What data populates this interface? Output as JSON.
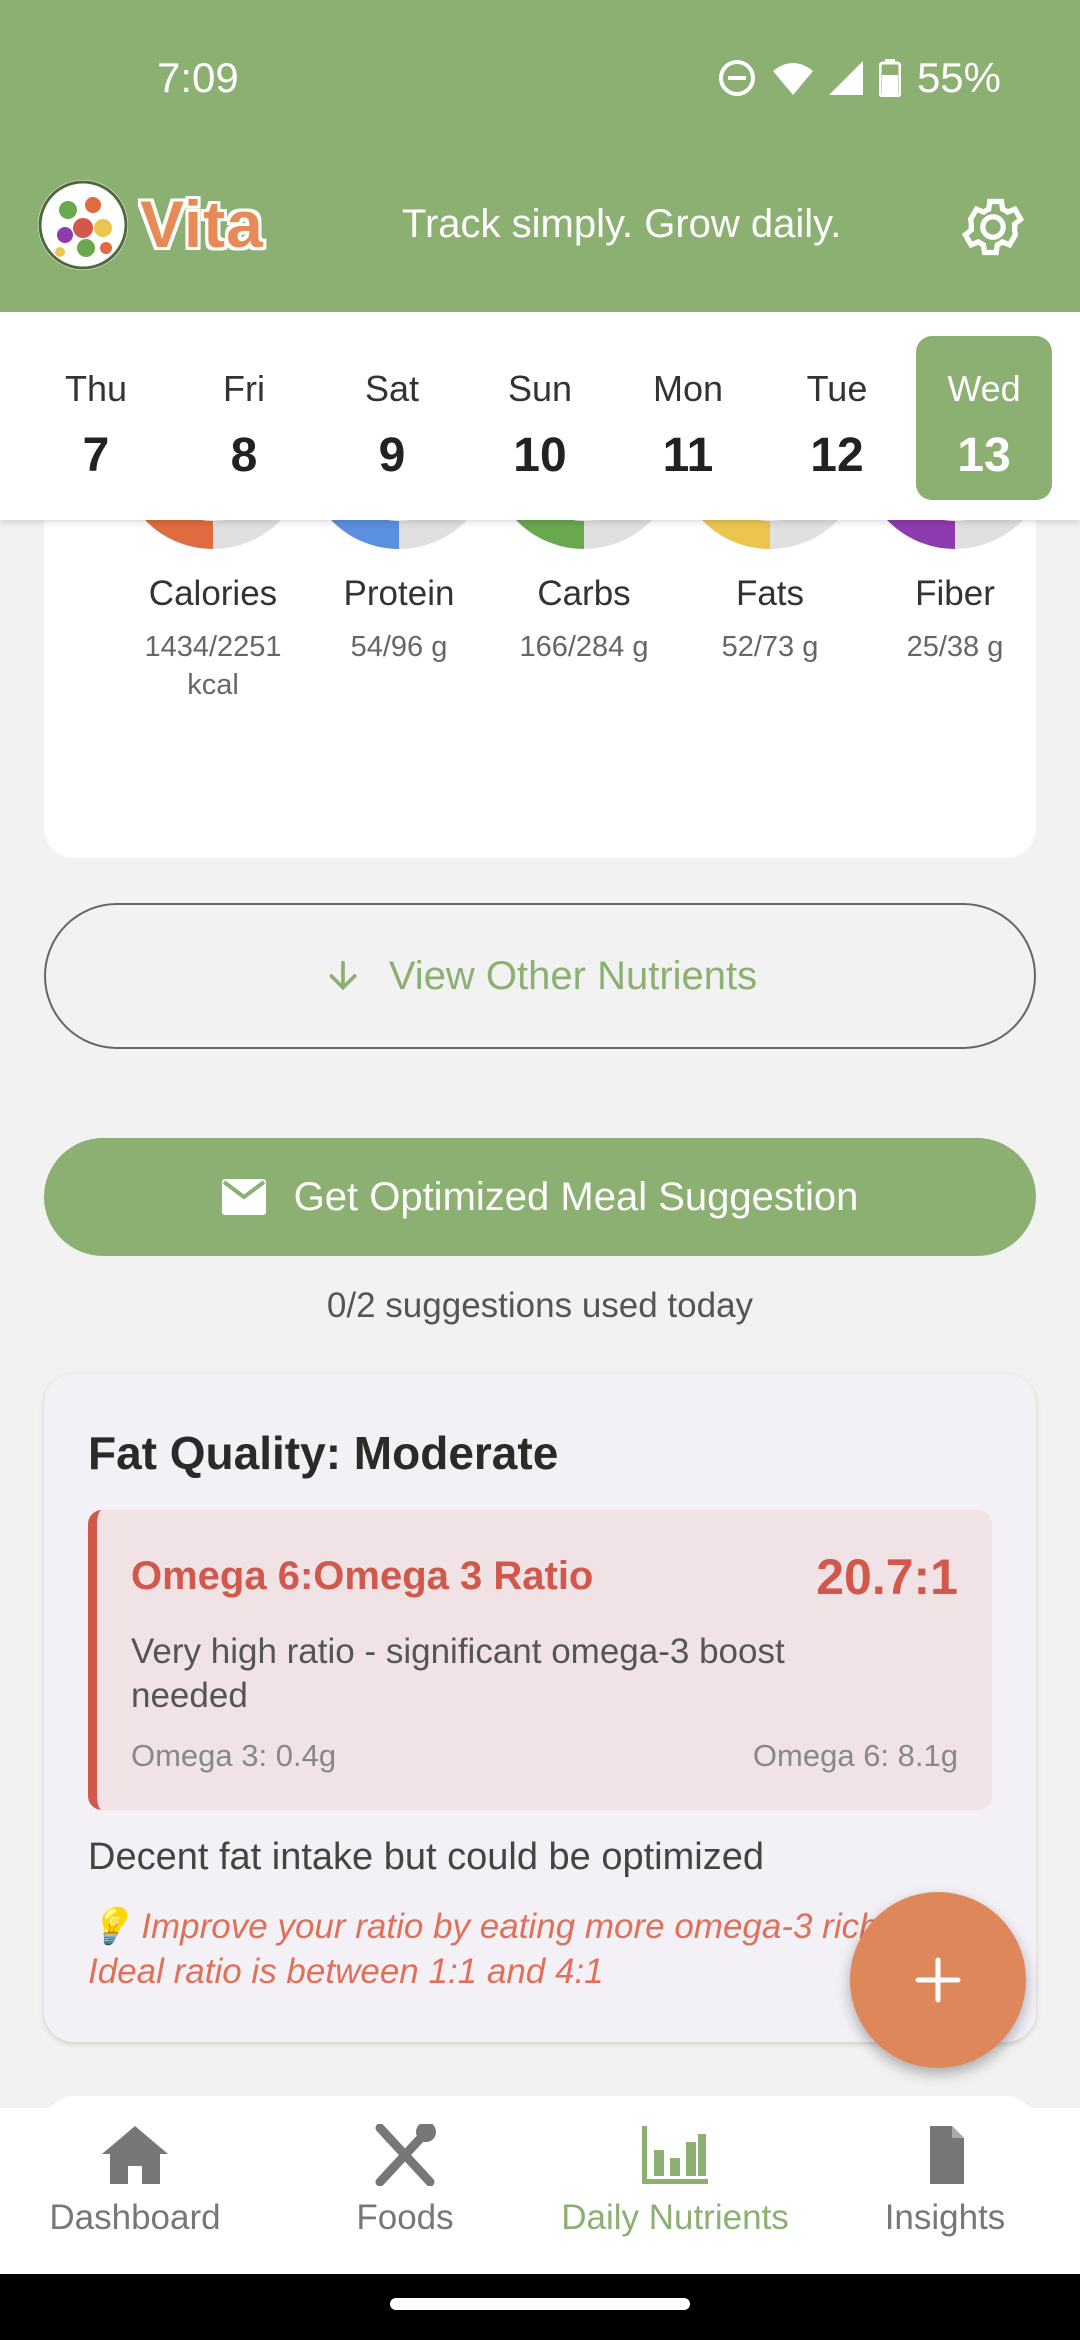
{
  "status_bar": {
    "time": "7:09",
    "battery": "55%"
  },
  "header": {
    "app_name": "Vita",
    "tagline": "Track simply. Grow daily.",
    "settings_icon": "gear-icon"
  },
  "days": [
    {
      "name": "Thu",
      "num": "7"
    },
    {
      "name": "Fri",
      "num": "8"
    },
    {
      "name": "Sat",
      "num": "9"
    },
    {
      "name": "Sun",
      "num": "10"
    },
    {
      "name": "Mon",
      "num": "11"
    },
    {
      "name": "Tue",
      "num": "12"
    },
    {
      "name": "Wed",
      "num": "13",
      "selected": true
    }
  ],
  "macros": [
    {
      "name": "Calories",
      "percent": "64%",
      "fraction": 0.64,
      "value": "1434/2251",
      "unit": "kcal",
      "color": "#e06b40"
    },
    {
      "name": "Protein",
      "percent": "57%",
      "fraction": 0.57,
      "value": "54/96 g",
      "color": "#5b8fe0"
    },
    {
      "name": "Carbs",
      "percent": "58%",
      "fraction": 0.58,
      "value": "166/284 g",
      "color": "#6aa84f"
    },
    {
      "name": "Fats",
      "percent": "71%",
      "fraction": 0.71,
      "value": "52/73 g",
      "color": "#ecc550"
    },
    {
      "name": "Fiber",
      "percent": "65%",
      "fraction": 0.65,
      "value": "25/38 g",
      "color": "#8e3bb0"
    }
  ],
  "view_other_label": "View Other Nutrients",
  "suggestion": {
    "button_label": "Get Optimized Meal Suggestion",
    "usage": "0/2 suggestions used today"
  },
  "fat_quality": {
    "title": "Fat Quality: Moderate",
    "ratio_label": "Omega 6:Omega 3 Ratio",
    "ratio_value": "20.7:1",
    "ratio_desc": "Very high ratio - significant omega-3 boost needed",
    "omega3": "Omega 3: 0.4g",
    "omega6": "Omega 6: 8.1g",
    "summary": "Decent fat intake but could be optimized",
    "tip": "💡 Improve your ratio by eating more omega-3 rich foods. Ideal ratio is between 1:1 and 4:1"
  },
  "nav": [
    {
      "label": "Dashboard",
      "icon": "home-icon"
    },
    {
      "label": "Foods",
      "icon": "utensils-icon"
    },
    {
      "label": "Daily Nutrients",
      "icon": "bar-chart-icon",
      "active": true
    },
    {
      "label": "Insights",
      "icon": "document-icon"
    }
  ],
  "colors": {
    "primary": "#8bb072",
    "accent": "#de875a",
    "danger": "#d1584a"
  }
}
